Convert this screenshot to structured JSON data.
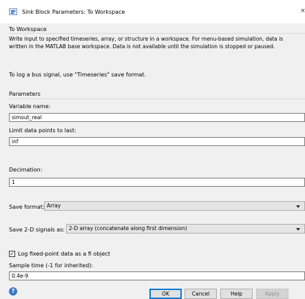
{
  "window": {
    "title": "Sink Block Parameters: To Workspace",
    "close_glyph": "×"
  },
  "block": {
    "name": "To Workspace",
    "description": "Write input to specified timeseries, array, or structure in a workspace. For menu-based simulation, data is written in the MATLAB base workspace. Data is not available until the simulation is stopped or paused.",
    "bus_note": "To log a bus signal, use \"Timeseries\" save format."
  },
  "parameters": {
    "heading": "Parameters",
    "variable_name_label": "Variable name:",
    "variable_name_value": "simout_real",
    "limit_label": "Limit data points to last:",
    "limit_value": "inf",
    "decimation_label": "Decimation:",
    "decimation_value": "1",
    "save_format_label": "Save format:",
    "save_format_value": "Array",
    "save_2d_label": "Save 2-D signals as:",
    "save_2d_value": "2-D array (concatenate along first dimension)",
    "log_fixed_point_label": "Log fixed-point data as a fi object",
    "log_fixed_point_checked": "✓",
    "sample_time_label": "Sample time (-1 for inherited):",
    "sample_time_value": "0.4e-9"
  },
  "buttons": {
    "ok": "OK",
    "cancel": "Cancel",
    "help": "Help",
    "apply": "Apply"
  },
  "icons": {
    "app": "simulink-block-icon",
    "help": "help-icon"
  }
}
